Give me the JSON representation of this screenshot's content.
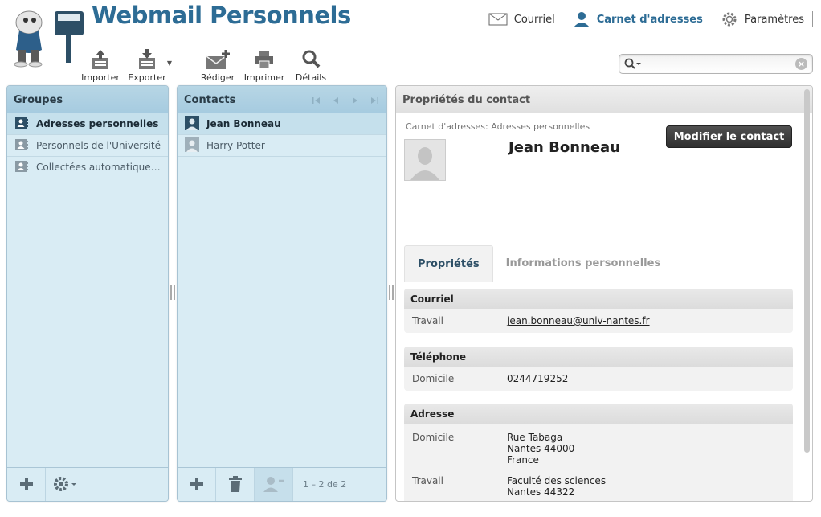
{
  "app": {
    "title": "Webmail Personnels"
  },
  "topnav": {
    "mail": "Courriel",
    "addressbook": "Carnet d'adresses",
    "settings": "Paramètres"
  },
  "toolbar": {
    "import": "Importer",
    "export": "Exporter",
    "compose": "Rédiger",
    "print": "Imprimer",
    "details": "Détails"
  },
  "search": {
    "value": "",
    "placeholder": ""
  },
  "groups": {
    "title": "Groupes",
    "items": [
      {
        "label": "Adresses personnelles",
        "selected": true
      },
      {
        "label": "Personnels de l'Université",
        "selected": false
      },
      {
        "label": "Collectées automatiquem…",
        "selected": false
      }
    ]
  },
  "contacts": {
    "title": "Contacts",
    "items": [
      {
        "label": "Jean Bonneau",
        "selected": true
      },
      {
        "label": "Harry Potter",
        "selected": false
      }
    ],
    "count": "1 – 2 de 2"
  },
  "details": {
    "title": "Propriétés du contact",
    "addressbook_line": "Carnet d'adresses:  Adresses personnelles",
    "edit_button": "Modifier le contact",
    "name": "Jean Bonneau",
    "tabs": [
      "Propriétés",
      "Informations personnelles"
    ],
    "email": {
      "legend": "Courriel",
      "label": "Travail",
      "value": "jean.bonneau@univ-nantes.fr"
    },
    "phone": {
      "legend": "Téléphone",
      "label": "Domicile",
      "value": "0244719252"
    },
    "address": {
      "legend": "Adresse",
      "home_label": "Domicile",
      "home_lines": [
        "Rue Tabaga",
        "Nantes 44000",
        "France"
      ],
      "work_label": "Travail",
      "work_lines": [
        "Faculté des sciences",
        "Nantes 44322"
      ]
    }
  },
  "colors": {
    "brand": "#2d6c95",
    "panel_bg": "#d9ecf4",
    "selected_bg": "#c5e0ec",
    "link": "#1e73b2"
  }
}
